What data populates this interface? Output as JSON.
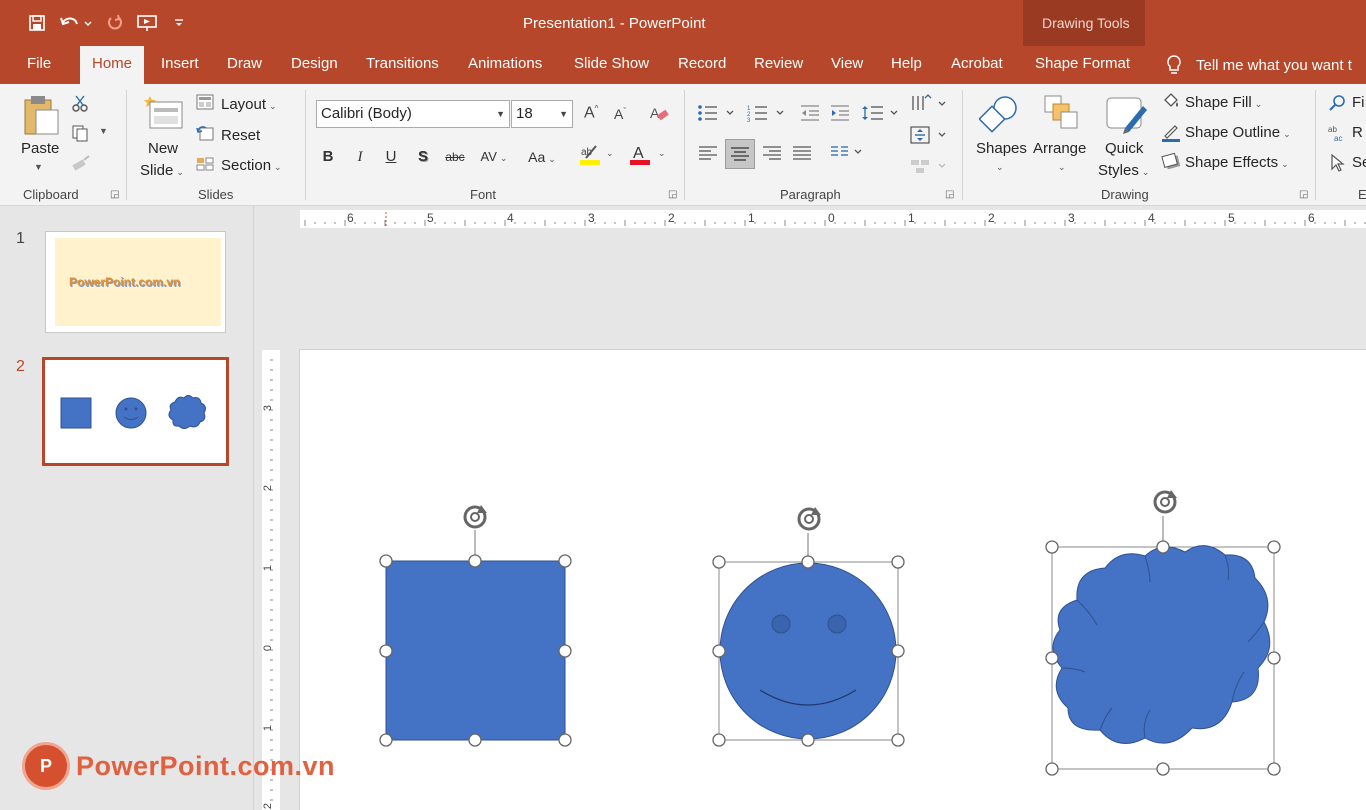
{
  "window": {
    "title": "Presentation1  -  PowerPoint",
    "context_label": "Drawing Tools"
  },
  "qat": {
    "save_icon": "save-icon",
    "undo_icon": "undo-icon",
    "redo_icon": "redo-icon",
    "present_icon": "present-icon",
    "customize_icon": "customize-icon"
  },
  "tabs": [
    {
      "label": "File"
    },
    {
      "label": "Home"
    },
    {
      "label": "Insert"
    },
    {
      "label": "Draw"
    },
    {
      "label": "Design"
    },
    {
      "label": "Transitions"
    },
    {
      "label": "Animations"
    },
    {
      "label": "Slide Show"
    },
    {
      "label": "Record"
    },
    {
      "label": "Review"
    },
    {
      "label": "View"
    },
    {
      "label": "Help"
    },
    {
      "label": "Acrobat"
    },
    {
      "label": "Shape Format"
    }
  ],
  "tell_me": "Tell me what you want t",
  "ribbon": {
    "clipboard": {
      "label": "Clipboard",
      "paste": "Paste"
    },
    "slides": {
      "label": "Slides",
      "new_slide_1": "New",
      "new_slide_2": "Slide",
      "layout": "Layout",
      "reset": "Reset",
      "section": "Section"
    },
    "font": {
      "label": "Font",
      "font_name": "Calibri (Body)",
      "font_size": "18"
    },
    "paragraph": {
      "label": "Paragraph"
    },
    "drawing": {
      "label": "Drawing",
      "shapes": "Shapes",
      "arrange": "Arrange",
      "quick_1": "Quick",
      "quick_2": "Styles",
      "shape_fill": "Shape Fill",
      "shape_outline": "Shape Outline",
      "shape_effects": "Shape Effects"
    },
    "editing": {
      "find": "Fi",
      "replace": "R",
      "select": "Se",
      "label": "E"
    }
  },
  "slides": [
    {
      "number": "1",
      "thumb_text": "PowerPoint.com.vn"
    },
    {
      "number": "2"
    }
  ],
  "ruler": {
    "h_ticks": [
      "6",
      "5",
      "4",
      "3",
      "2",
      "1",
      "0",
      "1",
      "2",
      "3",
      "4",
      "5",
      "6"
    ],
    "v_ticks": [
      "3",
      "2",
      "1",
      "0",
      "1",
      "2"
    ]
  },
  "colors": {
    "accent": "#b7472a",
    "shape_fill": "#4472c4",
    "shape_stroke": "#2f528f"
  },
  "watermark": "PowerPoint.com.vn"
}
